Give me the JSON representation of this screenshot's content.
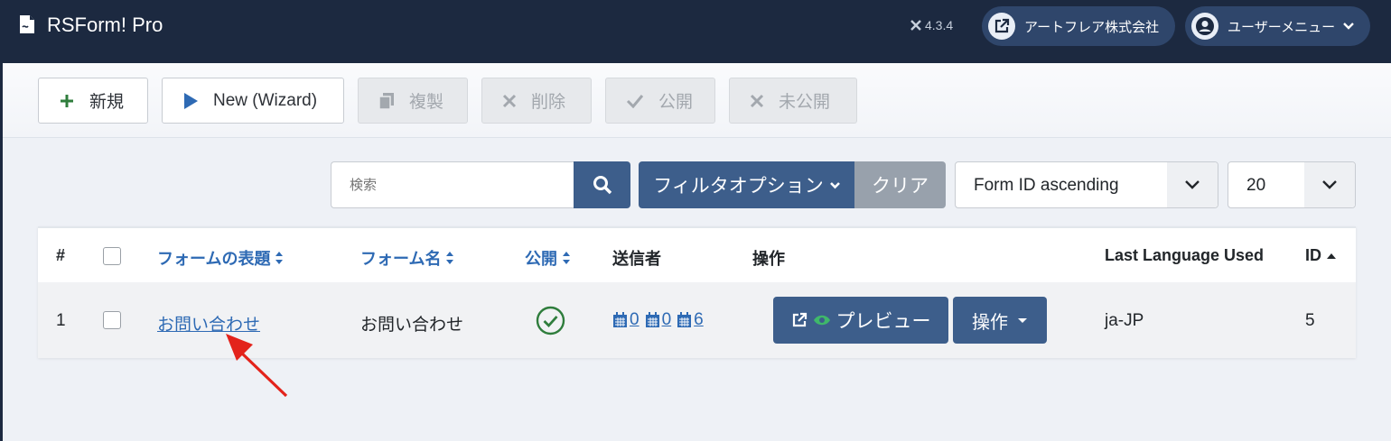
{
  "header": {
    "app_title": "RSForm! Pro",
    "version": "4.3.4",
    "site_button": "アートフレア株式会社",
    "user_menu": "ユーザーメニュー"
  },
  "toolbar": {
    "new_label": "新規",
    "wizard_label": "New (Wizard)",
    "copy_label": "複製",
    "delete_label": "削除",
    "publish_label": "公開",
    "unpublish_label": "未公開"
  },
  "filters": {
    "search_placeholder": "検索",
    "filter_options_label": "フィルタオプション",
    "clear_label": "クリア",
    "sort_value": "Form ID ascending",
    "limit_value": "20"
  },
  "table": {
    "headers": {
      "num": "#",
      "form_title": "フォームの表題",
      "form_name": "フォーム名",
      "published": "公開",
      "submissions": "送信者",
      "actions": "操作",
      "last_language": "Last Language Used",
      "id": "ID"
    },
    "rows": [
      {
        "num": "1",
        "form_title": "お問い合わせ",
        "form_name": "お問い合わせ",
        "submissions_today": "0",
        "submissions_month": "0",
        "submissions_total": "6",
        "preview_label": "プレビュー",
        "actions_label": "操作",
        "language": "ja-JP",
        "id": "5"
      }
    ]
  },
  "colors": {
    "topbar": "#1c2940",
    "primary_button": "#3d5e8b",
    "link": "#2e6ab4",
    "published_check": "#2f7d3c",
    "annotation_arrow": "#e3231b"
  }
}
